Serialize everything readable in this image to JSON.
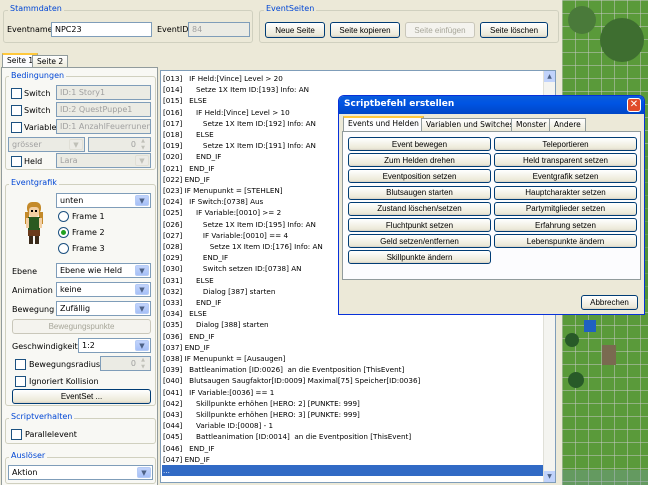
{
  "stammdaten": {
    "title": "Stammdaten",
    "eventname_label": "Eventname",
    "eventname_value": "NPC23",
    "eventid_label": "EventID",
    "eventid_value": "84"
  },
  "eventseiten": {
    "title": "EventSeiten",
    "btn_neue": "Neue Seite",
    "btn_kopieren": "Seite kopieren",
    "btn_einfuegen": "Seite einfügen",
    "btn_loeschen": "Seite löschen"
  },
  "page_tabs": [
    "Seite 1",
    "Seite 2"
  ],
  "bedingungen": {
    "title": "Bedingungen",
    "switch1_label": "Switch",
    "switch1_value": "ID:1 Story1",
    "switch2_label": "Switch",
    "switch2_value": "ID:2 QuestPuppe1",
    "variable_label": "Variable",
    "variable_value": "ID:1 AnzahlFeuerrunen",
    "compare_value": "grösser",
    "compare_num": "0",
    "held_label": "Held",
    "held_value": "Lara"
  },
  "eventgrafik": {
    "title": "Eventgrafik",
    "direction_value": "unten",
    "frame1": "Frame 1",
    "frame2": "Frame 2",
    "frame3": "Frame 3",
    "ebene_label": "Ebene",
    "ebene_value": "Ebene wie Held",
    "animation_label": "Animation",
    "animation_value": "keine",
    "bewegung_label": "Bewegung",
    "bewegung_value": "Zufällig",
    "bewegungspunkte_btn": "Bewegungspunkte",
    "geschwindigkeit_label": "Geschwindigkeit",
    "geschwindigkeit_value": "1:2",
    "bewegungsradius_label": "Bewegungsradius",
    "bewegungsradius_value": "0",
    "kollision_label": "Ignoriert Kollision",
    "eventset_btn": "EventSet ..."
  },
  "scriptverhalten": {
    "title": "Scriptverhalten",
    "parallel_label": "Parallelevent"
  },
  "ausloeser": {
    "title": "Auslöser",
    "value": "Aktion"
  },
  "script_lines": [
    "[013]   IF Held:[Vince] Level > 20",
    "[014]      Setze 1X Item ID:[193] Info: AN",
    "[015]   ELSE",
    "[016]      IF Held:[Vince] Level > 10",
    "[017]         Setze 1X Item ID:[192] Info: AN",
    "[018]      ELSE",
    "[019]         Setze 1X Item ID:[191] Info: AN",
    "[020]      END_IF",
    "[021]   END_IF",
    "[022] END_IF",
    "[023] IF Menupunkt = [STEHLEN]",
    "[024]   IF Switch:[0738] Aus",
    "[025]      IF Variable:[0010] >= 2",
    "[026]         Setze 1X Item ID:[195] Info: AN",
    "[027]         IF Variable:[0010] == 4",
    "[028]            Setze 1X Item ID:[176] Info: AN",
    "[029]         END_IF",
    "[030]         Switch setzen ID:[0738] AN",
    "[031]      ELSE",
    "[032]         Dialog [387] starten",
    "[033]      END_IF",
    "[034]   ELSE",
    "[035]      Dialog [388] starten",
    "[036]   END_IF",
    "[037] END_IF",
    "[038] IF Menupunkt = [Ausaugen]",
    "[039]   Battleanimation [ID:0026]  an die Eventposition [ThisEvent]",
    "[040]   Blutsaugen Saugfaktor[ID:0009] Maximal[75] Speicher[ID:0036]",
    "[041]   IF Variable:[0036] == 1",
    "[042]      Skillpunkte erhöhen [HERO: 2] [PUNKTE: 999]",
    "[043]      Skillpunkte erhöhen [HERO: 3] [PUNKTE: 999]",
    "[044]      Variable ID:[0008] - 1",
    "[045]      Battleanimation [ID:0014]  an die Eventposition [ThisEvent]",
    "[046]   END_IF",
    "[047] END_IF",
    "..."
  ],
  "dialog": {
    "title": "Scriptbefehl erstellen",
    "tabs": [
      "Events und Helden",
      "Variablen und Switches",
      "Monster",
      "Andere"
    ],
    "buttons": [
      "Event bewegen",
      "Teleportieren",
      "Zum Helden drehen",
      "Held transparent setzen",
      "Eventposition setzen",
      "Eventgrafik setzen",
      "Blutsaugen starten",
      "Hauptcharakter setzen",
      "Zustand löschen/setzen",
      "Partymitglieder setzen",
      "Fluchtpunkt setzen",
      "Erfahrung setzen",
      "Geld setzen/entfernen",
      "Lebenspunkte ändern",
      "Skillpunkte ändern"
    ],
    "cancel": "Abbrechen"
  }
}
